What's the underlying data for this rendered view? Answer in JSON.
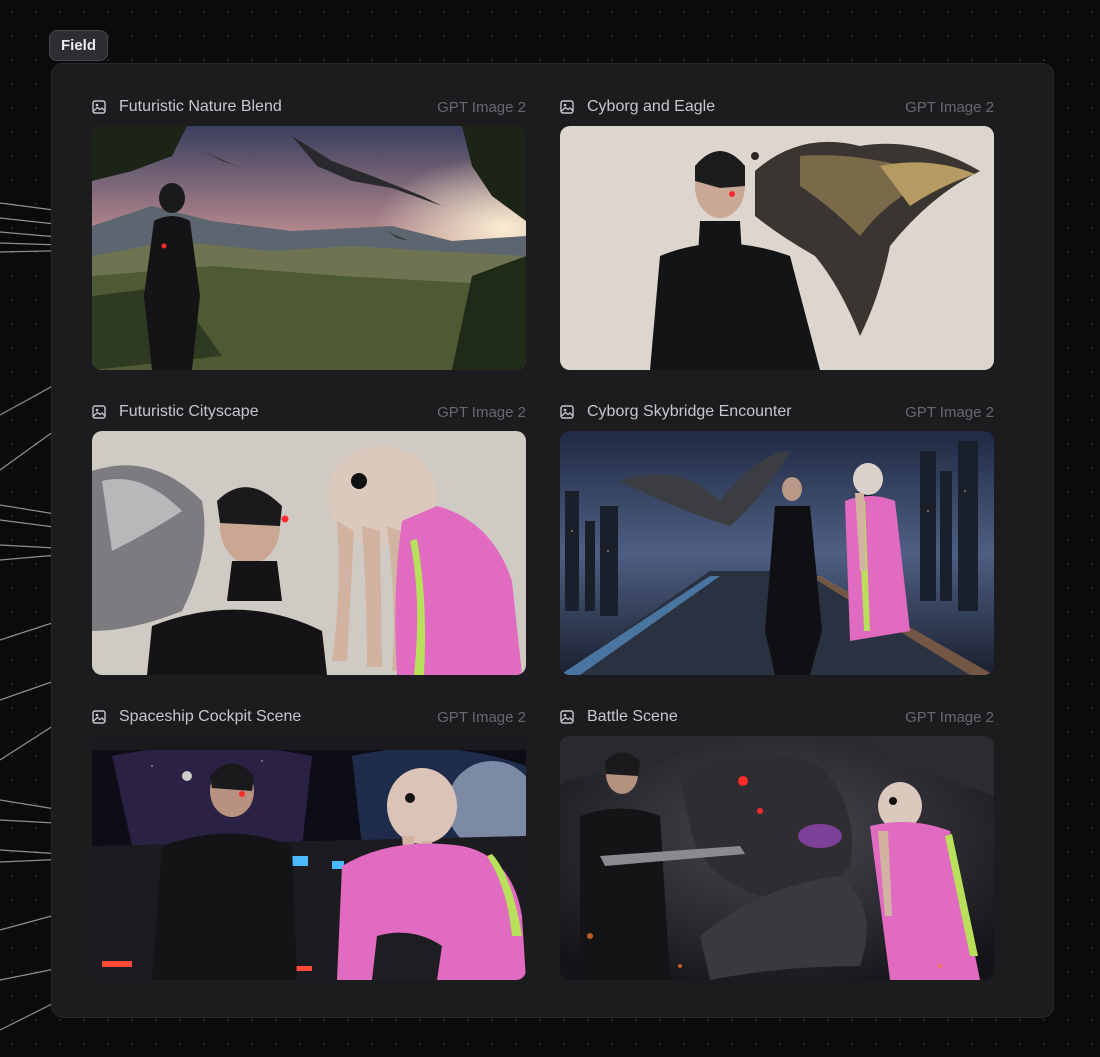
{
  "node": {
    "label": "Field"
  },
  "cards": [
    {
      "title": "Futuristic Nature Blend",
      "model": "GPT Image 2",
      "icon": "image-icon"
    },
    {
      "title": "Cyborg and Eagle",
      "model": "GPT Image 2",
      "icon": "image-icon"
    },
    {
      "title": "Futuristic Cityscape",
      "model": "GPT Image 2",
      "icon": "image-icon"
    },
    {
      "title": "Cyborg Skybridge Encounter",
      "model": "GPT Image 2",
      "icon": "image-icon"
    },
    {
      "title": "Spaceship Cockpit Scene",
      "model": "GPT Image 2",
      "icon": "image-icon"
    },
    {
      "title": "Battle Scene",
      "model": "GPT Image 2",
      "icon": "image-icon"
    }
  ],
  "colors": {
    "canvas": "#0b0b0c",
    "panel": "#1c1c1f",
    "connector": "#bdbdc2",
    "accent_pink": "#e06bc0",
    "accent_green": "#b8e05a",
    "eye_red": "#ff2a2a"
  }
}
